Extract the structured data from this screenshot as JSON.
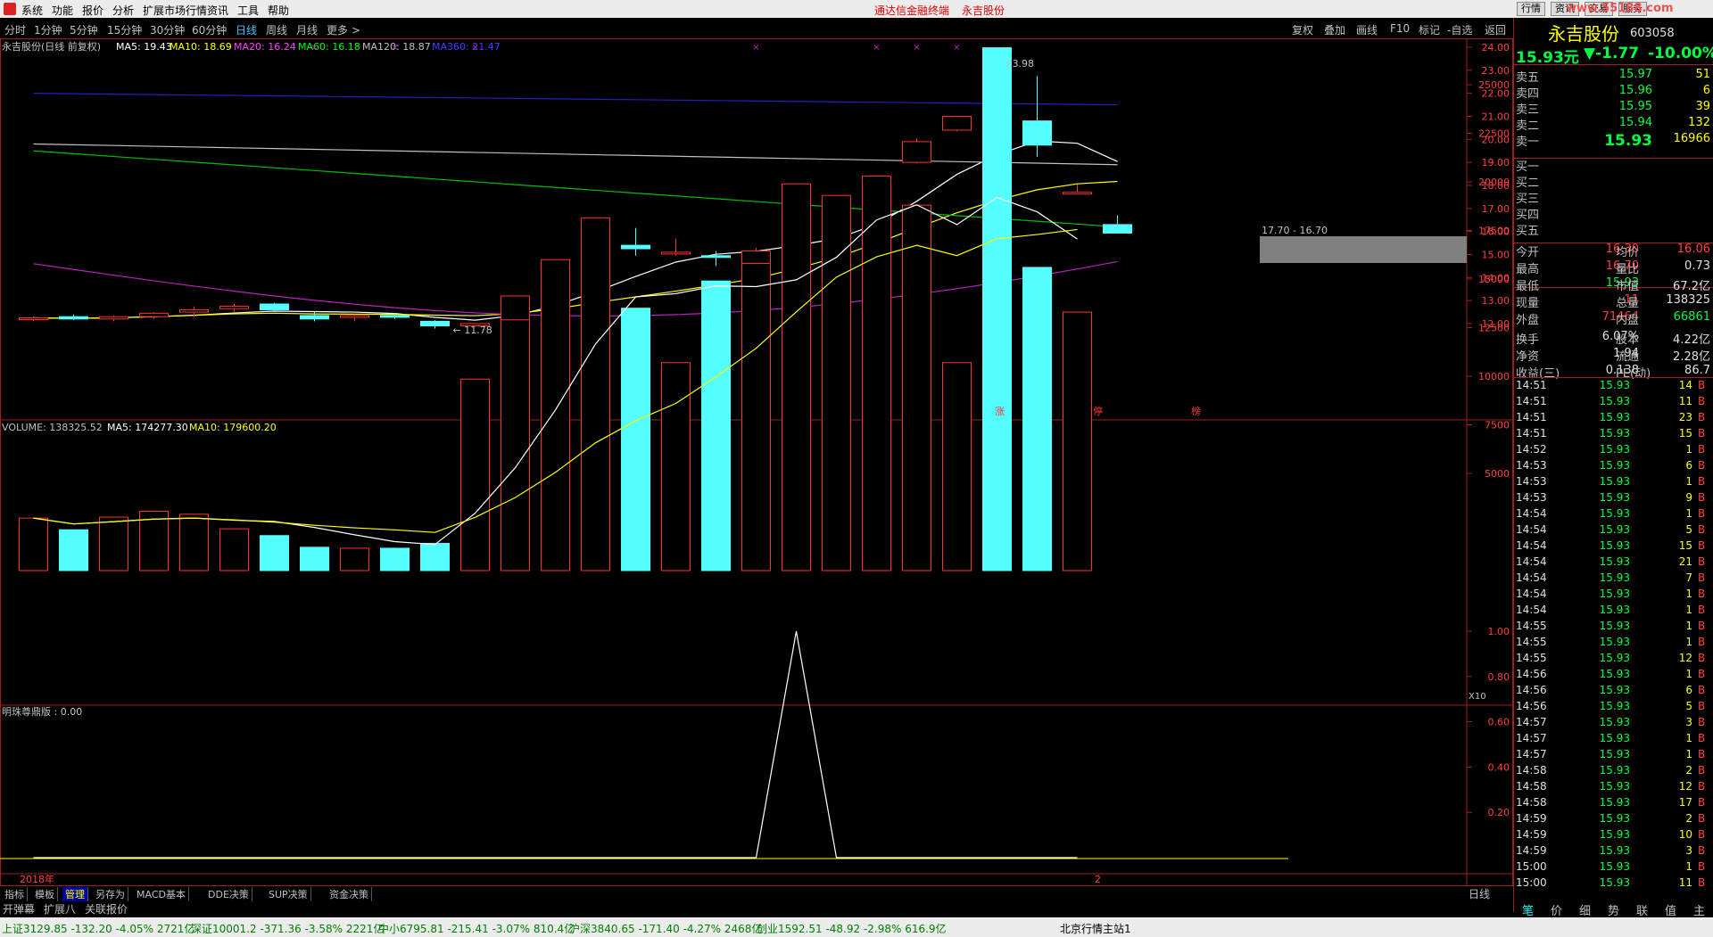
{
  "menu": {
    "items": [
      "系统",
      "功能",
      "报价",
      "分析",
      "扩展市场行情",
      "资讯",
      "工具",
      "帮助"
    ],
    "center_title": "通达信金融终端",
    "center_stock": "永吉股份",
    "right_buttons": [
      "行情",
      "资讯",
      "交易",
      "服务"
    ],
    "site": "www.55188.com"
  },
  "periods": [
    "分时",
    "1分钟",
    "5分钟",
    "15分钟",
    "30分钟",
    "60分钟",
    "日线",
    "周线",
    "月线",
    "更多 >"
  ],
  "active_period": "日线",
  "tools": [
    "复权",
    "叠加",
    "画线",
    "F10",
    "标记",
    "-自选",
    "返回"
  ],
  "ma_line": {
    "name": "永吉股份(日线 前复权)",
    "ma5": "MA5: 19.43",
    "ma10": "MA10: 18.69",
    "ma20": "MA20: 16.24",
    "ma60": "MA60: 16.18",
    "ma120": "MA120: 18.87",
    "ma360": "MA360: 21.47"
  },
  "vol_line": {
    "vol": "VOLUME: 138325.52",
    "ma5": "MA5: 174277.30",
    "ma10": "MA10: 179600.20"
  },
  "ind_line": "明珠尊鼎版 : 0.00",
  "price_axis": [
    "24.00",
    "23.00",
    "22.00",
    "21.00",
    "20.00",
    "19.00",
    "18.00",
    "17.00",
    "16.00",
    "15.00",
    "14.00",
    "13.00",
    "12.00"
  ],
  "vol_axis": [
    "25000",
    "22500",
    "20000",
    "17500",
    "15000",
    "12500",
    "10000",
    "7500",
    "5000"
  ],
  "vol_unit": "X10",
  "ind_axis": [
    "1.00",
    "0.80",
    "0.60",
    "0.40",
    "0.20"
  ],
  "annotations": {
    "high": "23.98",
    "low": "11.78",
    "range": "17.70 - 16.70",
    "year": "2018年",
    "month": "2",
    "tags": [
      "涨",
      "停",
      "榜"
    ]
  },
  "chart_data": {
    "type": "candlestick",
    "candles": [
      {
        "o": 12.2,
        "h": 12.3,
        "l": 12.1,
        "c": 12.25
      },
      {
        "o": 12.3,
        "h": 12.4,
        "l": 12.15,
        "c": 12.2
      },
      {
        "o": 12.2,
        "h": 12.35,
        "l": 12.1,
        "c": 12.3
      },
      {
        "o": 12.3,
        "h": 12.5,
        "l": 12.2,
        "c": 12.45
      },
      {
        "o": 12.5,
        "h": 12.75,
        "l": 12.3,
        "c": 12.6
      },
      {
        "o": 12.65,
        "h": 12.85,
        "l": 12.5,
        "c": 12.75
      },
      {
        "o": 12.85,
        "h": 12.9,
        "l": 12.5,
        "c": 12.6
      },
      {
        "o": 12.35,
        "h": 12.5,
        "l": 12.1,
        "c": 12.2
      },
      {
        "o": 12.3,
        "h": 12.4,
        "l": 12.1,
        "c": 12.35
      },
      {
        "o": 12.35,
        "h": 12.45,
        "l": 12.2,
        "c": 12.3
      },
      {
        "o": 12.1,
        "h": 12.15,
        "l": 11.78,
        "c": 11.9
      },
      {
        "o": 11.9,
        "h": 12.0,
        "l": 11.85,
        "c": 12.0
      },
      {
        "o": 12.0,
        "h": 13.2,
        "l": 12.0,
        "c": 13.2
      },
      {
        "o": 13.45,
        "h": 14.5,
        "l": 13.3,
        "c": 14.5
      },
      {
        "o": 15.0,
        "h": 15.3,
        "l": 14.95,
        "c": 15.3
      },
      {
        "o": 15.4,
        "h": 16.15,
        "l": 14.95,
        "c": 15.25
      },
      {
        "o": 15.05,
        "h": 15.7,
        "l": 14.95,
        "c": 15.1
      },
      {
        "o": 14.95,
        "h": 15.15,
        "l": 14.5,
        "c": 14.9
      },
      {
        "o": 14.3,
        "h": 15.3,
        "l": 14.3,
        "c": 15.15
      },
      {
        "o": 15.1,
        "h": 15.65,
        "l": 14.95,
        "c": 16.55
      },
      {
        "o": 16.65,
        "h": 17.25,
        "l": 16.4,
        "c": 16.75
      },
      {
        "o": 17.1,
        "h": 17.25,
        "l": 16.1,
        "c": 18.2
      },
      {
        "o": 19.0,
        "h": 20.05,
        "l": 18.95,
        "c": 19.9
      },
      {
        "o": 20.4,
        "h": 21.0,
        "l": 20.35,
        "c": 21.0
      },
      {
        "o": 22.8,
        "h": 23.98,
        "l": 20.8,
        "c": 20.8
      },
      {
        "o": 20.8,
        "h": 22.75,
        "l": 19.25,
        "c": 19.75
      },
      {
        "o": 17.7,
        "h": 18.05,
        "l": 17.65,
        "c": 17.7
      },
      {
        "o": 16.3,
        "h": 16.7,
        "l": 15.93,
        "c": 15.93
      }
    ],
    "volume": [
      2700,
      2100,
      2750,
      3050,
      2900,
      2150,
      1800,
      1200,
      1150,
      1150,
      1400,
      9850,
      12900,
      16000,
      18150,
      13500,
      10700,
      14900,
      15800,
      19900,
      19300,
      20300,
      18800,
      10700,
      26900,
      15600,
      13300
    ],
    "indicator": [
      0,
      0,
      0,
      0,
      0,
      0,
      0,
      0,
      0,
      0,
      0,
      0,
      0,
      0,
      0,
      0,
      0,
      0,
      0,
      1,
      0,
      0,
      0,
      0,
      0,
      0,
      0
    ],
    "ylim_price": [
      12.0,
      24.0
    ]
  },
  "quote": {
    "name": "永吉股份",
    "code": "603058",
    "price": "15.93元",
    "change": "▼-1.77",
    "pct": "-10.00%",
    "asks": [
      {
        "l": "卖五",
        "p": "15.97",
        "v": "51"
      },
      {
        "l": "卖四",
        "p": "15.96",
        "v": "6"
      },
      {
        "l": "卖三",
        "p": "15.95",
        "v": "39"
      },
      {
        "l": "卖二",
        "p": "15.94",
        "v": "132"
      },
      {
        "l": "卖一",
        "p": "15.93",
        "v": "16966"
      }
    ],
    "bids": [
      "买一",
      "买二",
      "买三",
      "买四",
      "买五"
    ],
    "stats": [
      [
        "今开",
        "16.30",
        "均价",
        "16.06"
      ],
      [
        "最高",
        "16.70",
        "量比",
        "0.73"
      ],
      [
        "最低",
        "15.93",
        "市值",
        "67.2亿"
      ],
      [
        "现量",
        "11",
        "总量",
        "138325"
      ],
      [
        "外盘",
        "71464",
        "内盘",
        "66861"
      ]
    ],
    "stats2": [
      [
        "换手",
        "6.07%",
        "股本",
        "4.22亿"
      ],
      [
        "净资",
        "1.94",
        "流通",
        "2.28亿"
      ],
      [
        "收益(三)",
        "0.138",
        "PE(动)",
        "86.7"
      ]
    ],
    "ticks": [
      [
        "14:51",
        "15.93",
        "14",
        "B"
      ],
      [
        "14:51",
        "15.93",
        "11",
        "B"
      ],
      [
        "14:51",
        "15.93",
        "23",
        "B"
      ],
      [
        "14:51",
        "15.93",
        "15",
        "B"
      ],
      [
        "14:52",
        "15.93",
        "1",
        "B"
      ],
      [
        "14:53",
        "15.93",
        "6",
        "B"
      ],
      [
        "14:53",
        "15.93",
        "1",
        "B"
      ],
      [
        "14:53",
        "15.93",
        "9",
        "B"
      ],
      [
        "14:54",
        "15.93",
        "1",
        "B"
      ],
      [
        "14:54",
        "15.93",
        "5",
        "B"
      ],
      [
        "14:54",
        "15.93",
        "15",
        "B"
      ],
      [
        "14:54",
        "15.93",
        "21",
        "B"
      ],
      [
        "14:54",
        "15.93",
        "7",
        "B"
      ],
      [
        "14:54",
        "15.93",
        "1",
        "B"
      ],
      [
        "14:54",
        "15.93",
        "1",
        "B"
      ],
      [
        "14:55",
        "15.93",
        "1",
        "B"
      ],
      [
        "14:55",
        "15.93",
        "1",
        "B"
      ],
      [
        "14:55",
        "15.93",
        "12",
        "B"
      ],
      [
        "14:56",
        "15.93",
        "1",
        "B"
      ],
      [
        "14:56",
        "15.93",
        "6",
        "B"
      ],
      [
        "14:56",
        "15.93",
        "5",
        "B"
      ],
      [
        "14:57",
        "15.93",
        "3",
        "B"
      ],
      [
        "14:57",
        "15.93",
        "1",
        "B"
      ],
      [
        "14:57",
        "15.93",
        "1",
        "B"
      ],
      [
        "14:58",
        "15.93",
        "2",
        "B"
      ],
      [
        "14:58",
        "15.93",
        "12",
        "B"
      ],
      [
        "14:58",
        "15.93",
        "17",
        "B"
      ],
      [
        "14:59",
        "15.93",
        "2",
        "B"
      ],
      [
        "14:59",
        "15.93",
        "10",
        "B"
      ],
      [
        "14:59",
        "15.93",
        "3",
        "B"
      ],
      [
        "15:00",
        "15.93",
        "1",
        "B"
      ],
      [
        "15:00",
        "15.93",
        "11",
        "B"
      ]
    ]
  },
  "bottom_tabs": [
    "指标",
    "模板",
    "管理",
    "另存为",
    "MACD基本",
    "DDE决策",
    "SUP决策",
    "资金决策"
  ],
  "bottom_tabs2": [
    "开弹幕",
    "扩展八",
    "关联报价"
  ],
  "right_tabs": [
    "笔",
    "价",
    "细",
    "势",
    "联",
    "值",
    "主"
  ],
  "period_label": "日线",
  "status": [
    "上证3129.85 -132.20 -4.05% 2721亿",
    "深证10001.2 -371.36 -3.58% 2221亿",
    "中小6795.81 -215.41 -3.07% 810.4亿",
    "沪深3840.65 -171.40 -4.27% 2468亿",
    "创业1592.51 -48.92 -2.98% 616.9亿",
    "北京行情主站1"
  ]
}
